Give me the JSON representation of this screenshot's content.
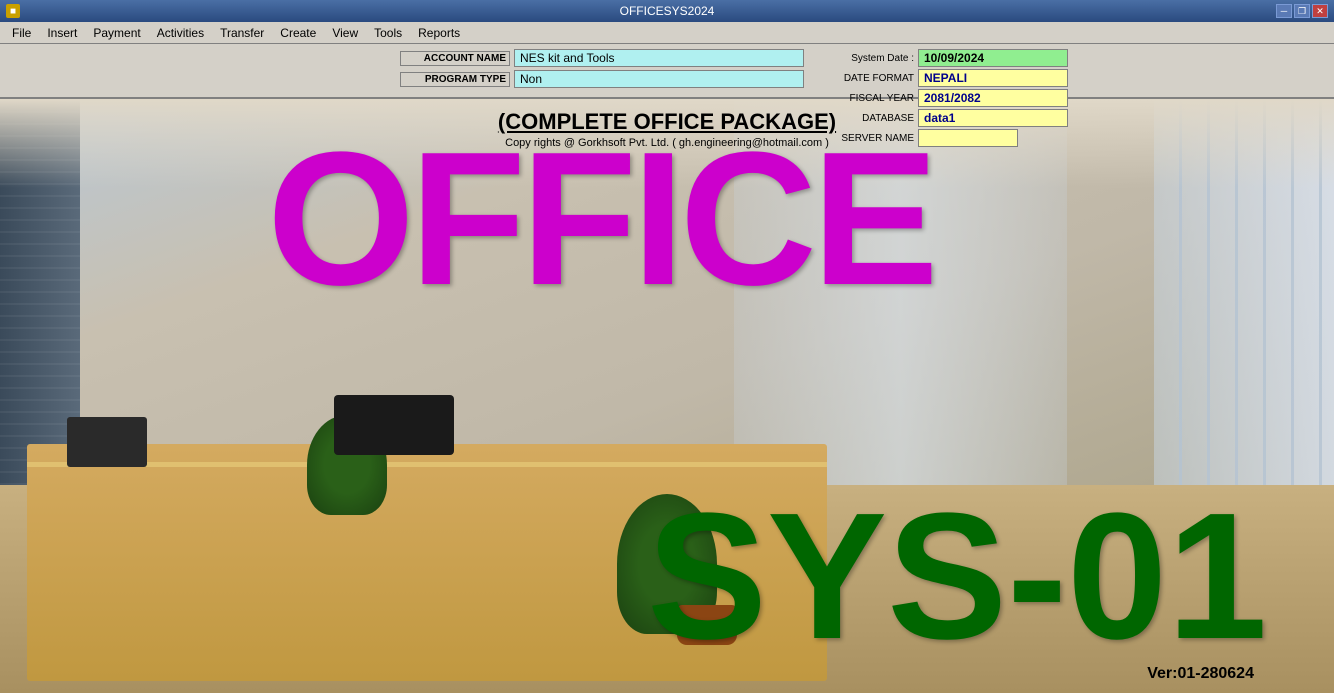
{
  "titlebar": {
    "title": "OFFICESYS2024",
    "controls": {
      "minimize": "─",
      "restore": "❐",
      "close": "✕"
    }
  },
  "menubar": {
    "items": [
      "File",
      "Insert",
      "Payment",
      "Activities",
      "Transfer",
      "Create",
      "View",
      "Tools",
      "Reports"
    ]
  },
  "infobar": {
    "account_name_label": "ACCOUNT NAME",
    "account_name_value": "NES kit and Tools",
    "program_type_label": "PROGRAM TYPE",
    "program_type_value": "Non"
  },
  "rightpanel": {
    "system_date_label": "System Date  :",
    "system_date_value": "10/09/2024",
    "date_format_label": "DATE FORMAT",
    "date_format_value": "NEPALI",
    "fiscal_year_label": "FISCAL YEAR",
    "fiscal_year_value": "2081/2082",
    "database_label": "DATABASE",
    "database_value": "data1",
    "server_name_label": "SERVER NAME",
    "server_name_value": ""
  },
  "main": {
    "package_title": "(COMPLETE OFFICE PACKAGE)",
    "copyright": "Copy rights @ Gorkhsoft Pvt. Ltd.  ( gh.engineering@hotmail.com )",
    "office_text": "OFFICE",
    "sys01_text": "SYS-01",
    "version_text": "Ver:01-280624"
  }
}
